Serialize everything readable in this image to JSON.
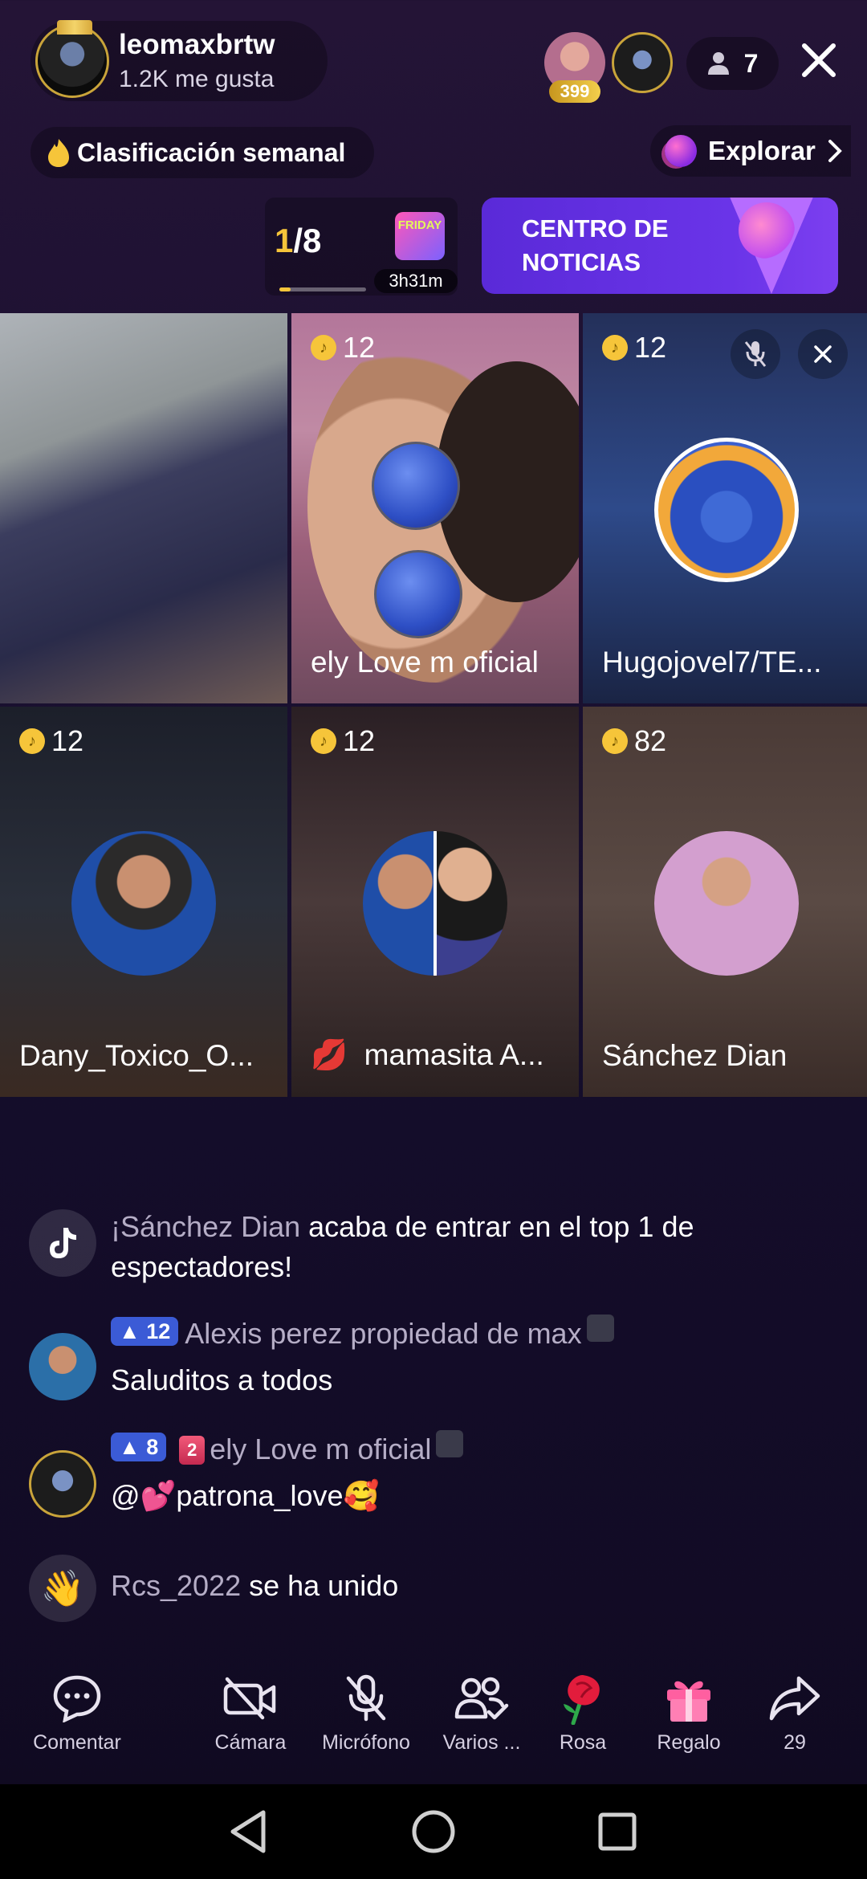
{
  "header": {
    "host_name": "leomaxbrtw",
    "host_likes": "1.2K me gusta",
    "top_viewer_badge": "399",
    "viewer_count": "7"
  },
  "weekly": {
    "label": "Clasificación semanal"
  },
  "explore": {
    "label": "Explorar"
  },
  "pager": {
    "current": "1",
    "total": "/8",
    "timer": "3h31m",
    "event": "FRIDAY"
  },
  "news": {
    "label": "CENTRO DE NOTICIAS"
  },
  "tiles": [
    {
      "coins": "",
      "name": ""
    },
    {
      "coins": "12",
      "name": "ely Love m oficial"
    },
    {
      "coins": "12",
      "name": "Hugojovel7/TE..."
    },
    {
      "coins": "12",
      "name": "Dany_Toxico_O..."
    },
    {
      "coins": "12",
      "name": "mamasita A..."
    },
    {
      "coins": "82",
      "name": "Sánchez Dian"
    }
  ],
  "chat": [
    {
      "user": "¡Sánchez Dian",
      "text": " acaba de entrar en el top 1 de espectadores!"
    },
    {
      "level": "12",
      "user": "Alexis perez propiedad de max",
      "text": "Saluditos a todos"
    },
    {
      "level": "8",
      "rank": "2",
      "user": "ely Love m oficial",
      "text": "@💕patrona_love🥰"
    },
    {
      "user": "Rcs_2022",
      "text": " se ha unido"
    }
  ],
  "bottom": {
    "comment": "Comentar",
    "camera": "Cámara",
    "mic": "Micrófono",
    "multi": "Varios ...",
    "rose": "Rosa",
    "gift": "Regalo",
    "share": "29"
  },
  "colors": {
    "accent": "#f6c53a",
    "news_bg": "#5a2ad8",
    "level_badge": "#3b5bd6"
  }
}
